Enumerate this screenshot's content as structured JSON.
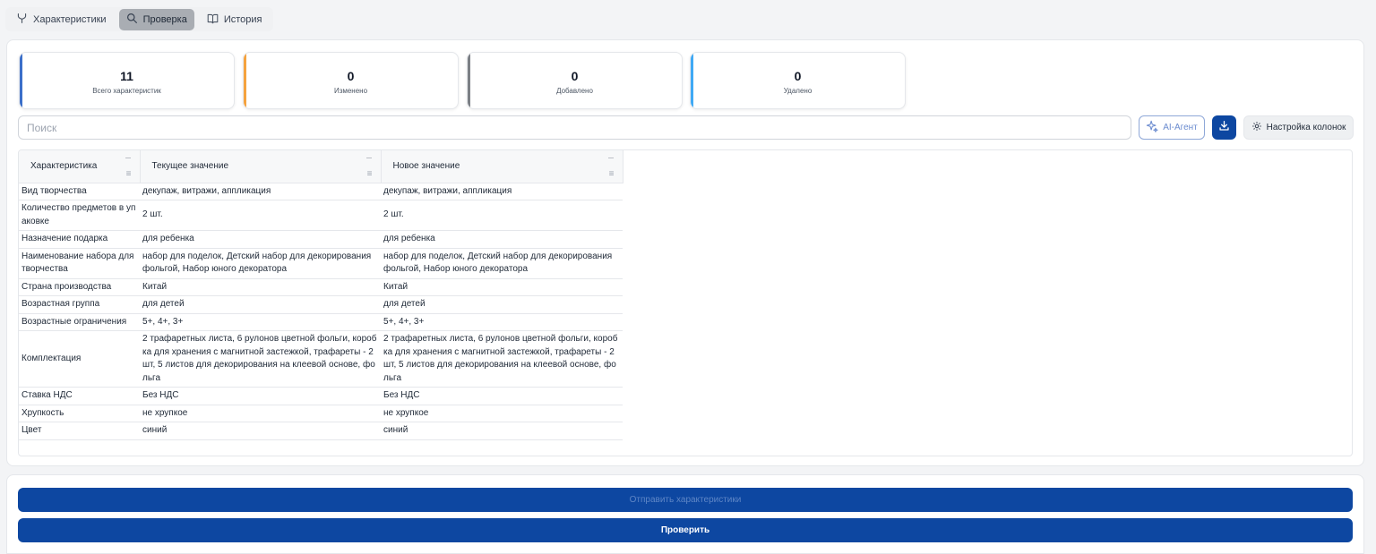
{
  "tabs": [
    {
      "label": "Характеристики",
      "icon": "fork-icon"
    },
    {
      "label": "Проверка",
      "icon": "search-icon",
      "active": true
    },
    {
      "label": "История",
      "icon": "book-icon"
    }
  ],
  "stats": [
    {
      "value": "11",
      "label": "Всего характеристик",
      "color": "#3b6fc9"
    },
    {
      "value": "0",
      "label": "Изменено",
      "color": "#f5a23d"
    },
    {
      "value": "0",
      "label": "Добавлено",
      "color": "#7b7f85"
    },
    {
      "value": "0",
      "label": "Удалено",
      "color": "#3fa9f5"
    }
  ],
  "search": {
    "placeholder": "Поиск",
    "value": ""
  },
  "toolbar": {
    "ai_label": "AI-Агент",
    "columns_label": "Настройка колонок",
    "accent": "#0d47a1"
  },
  "table": {
    "columns": [
      "Характеристика",
      "Текущее значение",
      "Новое значение"
    ],
    "rows": [
      {
        "name": "Вид творчества",
        "current": "декупаж, витражи, аппликация",
        "new": "декупаж, витражи, аппликация"
      },
      {
        "name": "Количество предметов в упаковке",
        "current": "2 шт.",
        "new": "2 шт."
      },
      {
        "name": "Назначение подарка",
        "current": "для ребенка",
        "new": "для ребенка"
      },
      {
        "name": "Наименование набора для творчества",
        "current": "набор для поделок, Детский набор для декорирования фольгой, Набор юного декоратора",
        "new": "набор для поделок, Детский набор для декорирования фольгой, Набор юного декоратора"
      },
      {
        "name": "Страна производства",
        "current": "Китай",
        "new": "Китай"
      },
      {
        "name": "Возрастная группа",
        "current": "для детей",
        "new": "для детей"
      },
      {
        "name": "Возрастные ограничения",
        "current": "5+, 4+, 3+",
        "new": "5+, 4+, 3+"
      },
      {
        "name": "Комплектация",
        "current": "2 трафаретных листа, 6 рулонов цветной фольги, коробка для хранения с магнитной застежкой, трафареты - 2 шт, 5 листов для декорирования на клеевой основе, фольга",
        "new": "2 трафаретных листа, 6 рулонов цветной фольги, коробка для хранения с магнитной застежкой, трафареты - 2 шт, 5 листов для декорирования на клеевой основе, фольга"
      },
      {
        "name": "Ставка НДС",
        "current": "Без НДС",
        "new": "Без НДС"
      },
      {
        "name": "Хрупкость",
        "current": "не хрупкое",
        "new": "не хрупкое"
      },
      {
        "name": "Цвет",
        "current": "синий",
        "new": "синий"
      }
    ]
  },
  "footer": {
    "send_label": "Отправить характеристики",
    "check_label": "Проверить"
  }
}
